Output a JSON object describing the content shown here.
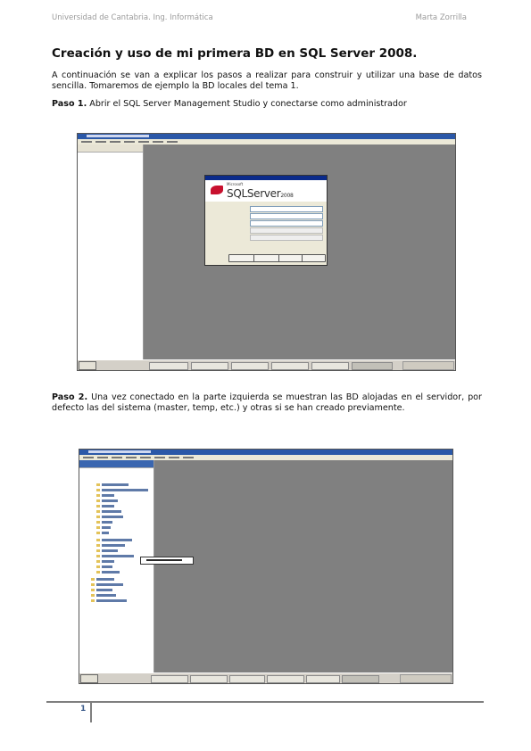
{
  "header": {
    "left": "Universidad de Cantabria. Ing. Informática",
    "right": "Marta Zorrilla"
  },
  "title": "Creación y uso de mi primera BD en SQL Server 2008.",
  "intro": "A continuación se van a explicar los pasos a realizar para construir y utilizar una base de datos sencilla. Tomaremos de ejemplo la BD locales del tema 1.",
  "steps": [
    {
      "label": "Paso 1.",
      "text": "Abrir el SQL Server Management Studio y conectarse como administrador"
    },
    {
      "label": "Paso 2.",
      "text": "Una vez conectado en la parte izquierda se muestran las BD alojadas en el servidor, por defecto las del sistema (master, temp, etc.) y otras si se han creado previamente."
    }
  ],
  "screenshot1": {
    "dialog_logo_small": "Microsoft",
    "dialog_logo": "SQLServer",
    "dialog_logo_version": "2008"
  },
  "footer": {
    "page_number": "1"
  },
  "colors": {
    "page_number": "#3a5a8a",
    "workspace": "#808080",
    "xp_title": "#2b58a8"
  }
}
